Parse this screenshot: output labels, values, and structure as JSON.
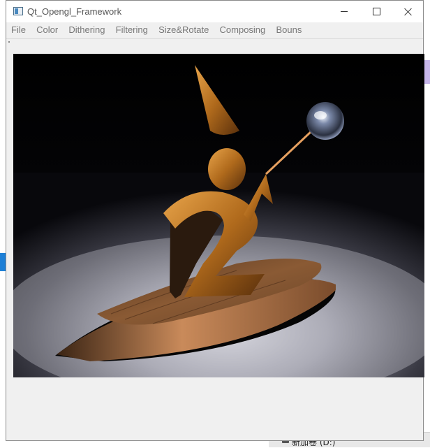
{
  "window": {
    "title": "Qt_Opengl_Framework"
  },
  "menu": {
    "items": [
      "File",
      "Color",
      "Dithering",
      "Filtering",
      "Size&Rotate",
      "Composing",
      "Bouns"
    ]
  },
  "background": {
    "drive_label": "新加卷 (D:)"
  },
  "colors": {
    "accent_blue": "#1d7fd6",
    "purple_tab": "#c7b6ea",
    "wood": "#c98a4a",
    "copper": "#d08a2e"
  },
  "icons": [
    "app-icon",
    "minimize-icon",
    "maximize-icon",
    "close-icon",
    "drive-icon"
  ]
}
